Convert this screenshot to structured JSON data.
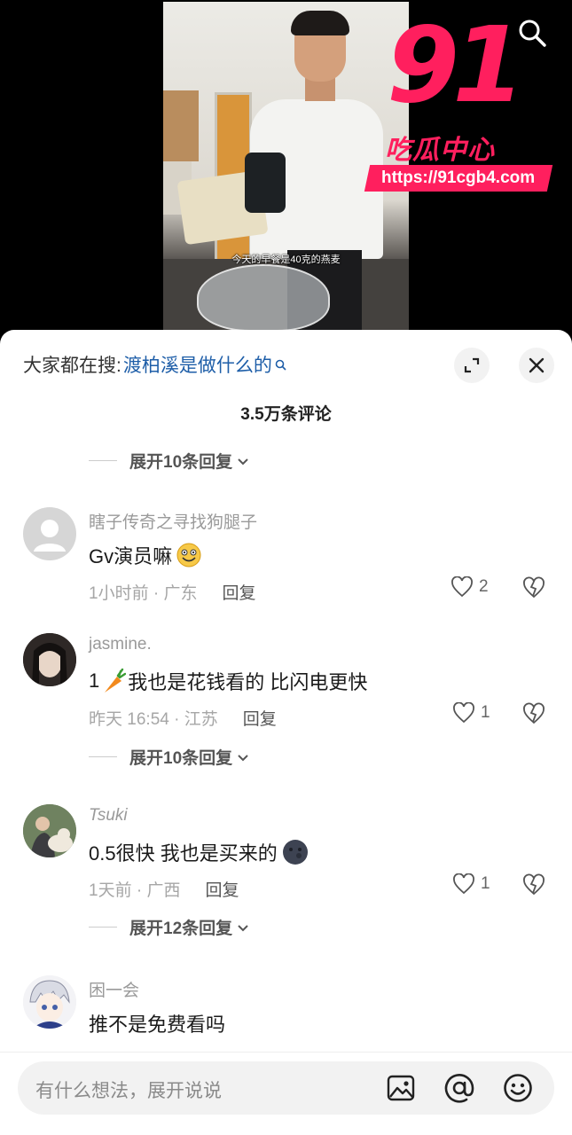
{
  "video": {
    "subtitle": "今天的早餐是40克的燕麦",
    "watermark": {
      "big": "91",
      "text": "吃瓜中心",
      "url": "https://91cgb4.com"
    }
  },
  "sheet": {
    "hot_search_prefix": "大家都在搜:",
    "hot_search_link": "渡柏溪是做什么的",
    "comment_count": "3.5万条评论",
    "expand_top": "展开10条回复",
    "comments": [
      {
        "user": "瞎子传奇之寻找狗腿子",
        "text": "Gv演员嘛",
        "meta": "1小时前 · 广东",
        "reply": "回复",
        "likes": "2"
      },
      {
        "user": "jasmine.",
        "text_prefix": "1",
        "text": "我也是花钱看的 比闪电更快",
        "meta": "昨天 16:54 · 江苏",
        "reply": "回复",
        "likes": "1",
        "expand": "展开10条回复"
      },
      {
        "user": "Tsuki",
        "text": "0.5很快 我也是买来的",
        "meta": "1天前 · 广西",
        "reply": "回复",
        "likes": "1",
        "expand": "展开12条回复"
      },
      {
        "user": "困一会",
        "text": "推不是免费看吗"
      }
    ],
    "input_placeholder": "有什么想法，展开说说"
  },
  "colors": {
    "link": "#1e5ea8",
    "watermark": "#ff1f5e"
  },
  "icons": [
    "search-icon",
    "expand-icon",
    "close-icon",
    "heart-icon",
    "broken-heart-icon",
    "image-icon",
    "at-icon",
    "emoji-icon",
    "chevron-down-icon"
  ]
}
